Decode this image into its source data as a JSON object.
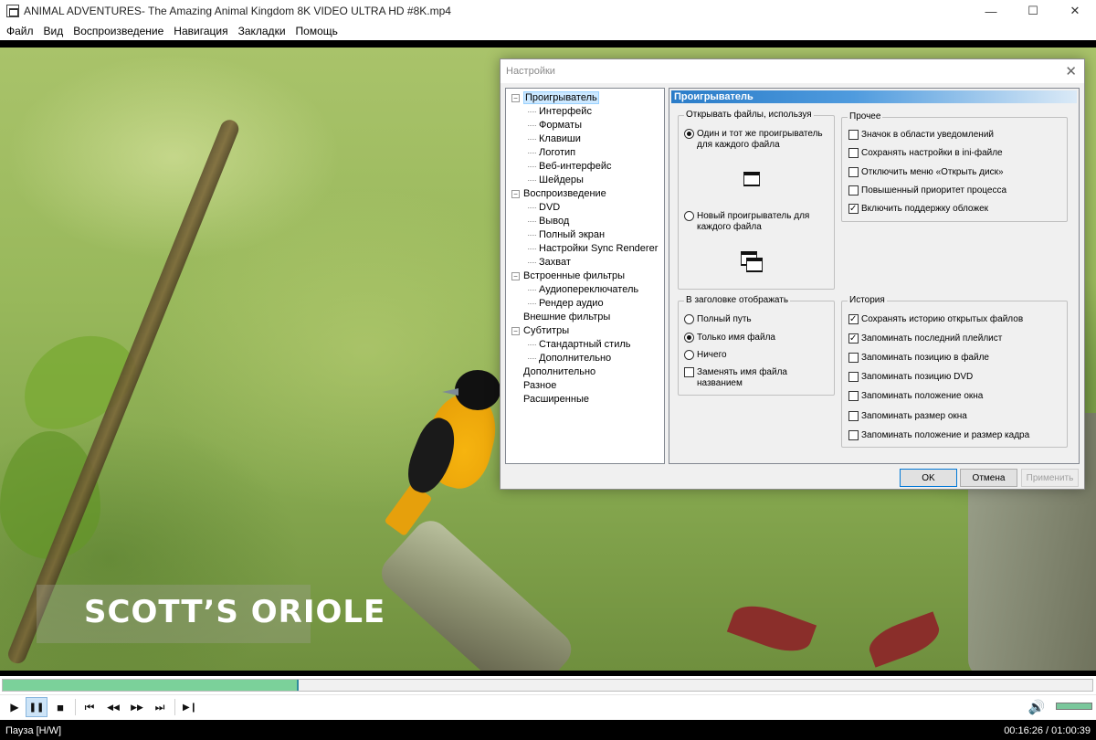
{
  "window": {
    "title": "ANIMAL ADVENTURES- The Amazing Animal Kingdom 8K VIDEO ULTRA HD #8K.mp4",
    "minimize": "—",
    "maximize": "☐",
    "close": "✕"
  },
  "menubar": [
    "Файл",
    "Вид",
    "Воспроизведение",
    "Навигация",
    "Закладки",
    "Помощь"
  ],
  "video": {
    "caption": "SCOTT’S ORIOLE"
  },
  "dialog": {
    "title": "Настройки",
    "close": "✕",
    "tree": [
      {
        "label": "Проигрыватель",
        "level": 0,
        "expander": "−",
        "selected": true
      },
      {
        "label": "Интерфейс",
        "level": 1
      },
      {
        "label": "Форматы",
        "level": 1
      },
      {
        "label": "Клавиши",
        "level": 1
      },
      {
        "label": "Логотип",
        "level": 1
      },
      {
        "label": "Веб-интерфейс",
        "level": 1
      },
      {
        "label": "Шейдеры",
        "level": 1
      },
      {
        "label": "Воспроизведение",
        "level": 0,
        "expander": "−"
      },
      {
        "label": "DVD",
        "level": 1
      },
      {
        "label": "Вывод",
        "level": 1
      },
      {
        "label": "Полный экран",
        "level": 1
      },
      {
        "label": "Настройки Sync Renderer",
        "level": 1
      },
      {
        "label": "Захват",
        "level": 1
      },
      {
        "label": "Встроенные фильтры",
        "level": 0,
        "expander": "−"
      },
      {
        "label": "Аудиопереключатель",
        "level": 1
      },
      {
        "label": "Рендер аудио",
        "level": 1
      },
      {
        "label": "Внешние фильтры",
        "level": 0
      },
      {
        "label": "Субтитры",
        "level": 0,
        "expander": "−"
      },
      {
        "label": "Стандартный стиль",
        "level": 1
      },
      {
        "label": "Дополнительно",
        "level": 1
      },
      {
        "label": "Дополнительно",
        "level": 0
      },
      {
        "label": "Разное",
        "level": 0
      },
      {
        "label": "Расширенные",
        "level": 0
      }
    ],
    "page_title": "Проигрыватель",
    "open_files": {
      "title": "Открывать файлы, используя",
      "same_player": "Один и тот же проигрыватель для каждого файла",
      "same_player_checked": true,
      "new_player": "Новый проигрыватель для каждого файла",
      "new_player_checked": false
    },
    "title_display": {
      "title": "В заголовке отображать",
      "full_path": "Полный путь",
      "full_path_checked": false,
      "file_name_only": "Только имя файла",
      "file_name_only_checked": true,
      "nothing": "Ничего",
      "nothing_checked": false,
      "replace_name": "Заменять имя файла названием",
      "replace_name_checked": false
    },
    "misc": {
      "title": "Прочее",
      "items": [
        {
          "label": "Значок в области уведомлений",
          "checked": false
        },
        {
          "label": "Сохранять настройки в ini-файле",
          "checked": false
        },
        {
          "label": "Отключить меню «Открыть диск»",
          "checked": false
        },
        {
          "label": "Повышенный приоритет процесса",
          "checked": false
        },
        {
          "label": "Включить поддержку обложек",
          "checked": true
        }
      ]
    },
    "history": {
      "title": "История",
      "items": [
        {
          "label": "Сохранять историю открытых файлов",
          "checked": true
        },
        {
          "label": "Запоминать последний плейлист",
          "checked": true
        },
        {
          "label": "Запоминать позицию в файле",
          "checked": false
        },
        {
          "label": "Запоминать позицию DVD",
          "checked": false
        },
        {
          "label": "Запоминать положение окна",
          "checked": false
        },
        {
          "label": "Запоминать размер окна",
          "checked": false
        },
        {
          "label": "Запоминать положение и размер кадра",
          "checked": false
        }
      ]
    },
    "buttons": {
      "ok": "OK",
      "cancel": "Отмена",
      "apply": "Применить"
    }
  },
  "player": {
    "progress_percent": 27.2,
    "volume_percent": 100,
    "controls": {
      "play": "▶",
      "pause": "❚❚",
      "stop": "■",
      "prev": "⏮",
      "rewind": "◀◀",
      "forward": "▶▶",
      "next": "⏭",
      "frame_step": "▶❙",
      "volume": "🔊"
    }
  },
  "status": {
    "state": "Пауза [H/W]",
    "time": "00:16:26 / 01:00:39"
  }
}
